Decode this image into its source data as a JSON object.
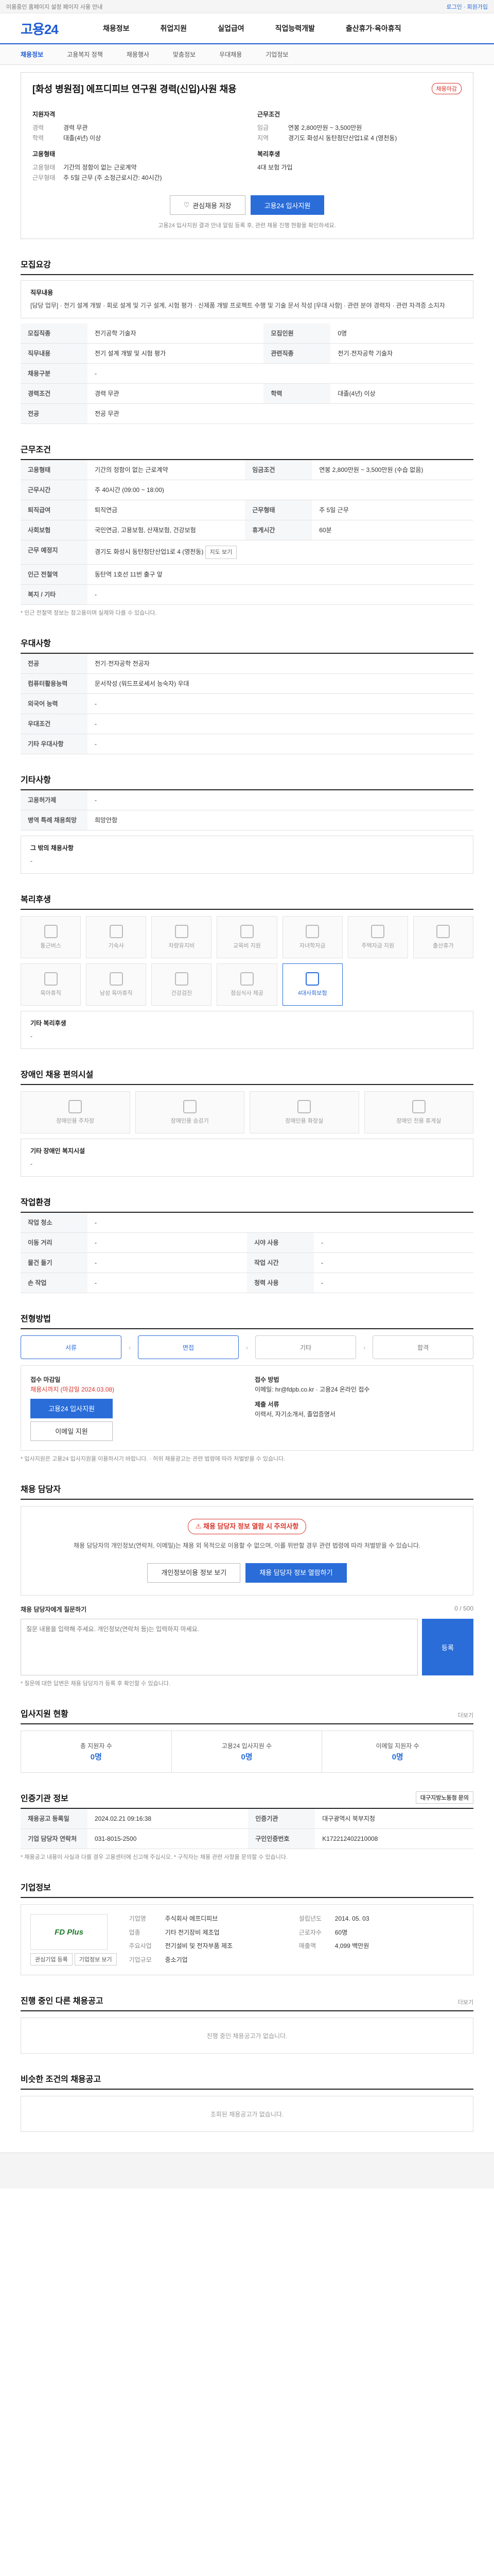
{
  "topbar": {
    "left": "이용중인 홈페이지 설정 페이지 사용 안내",
    "right": "로그인 · 회원가입"
  },
  "header": {
    "logo": "고용24",
    "menus": [
      "채용정보",
      "취업지원",
      "실업급여",
      "직업능력개발",
      "출산휴가·육아휴직"
    ]
  },
  "subnav": [
    "채용정보",
    "고용복지 정책",
    "채용행사",
    "맞춤정보",
    "우대채용",
    "기업정보"
  ],
  "job": {
    "title": "[화성 병원점] 에프디피브 연구원 경력(신입)사원 채용",
    "badge": "채용마감",
    "left_head": "지원자격",
    "left": [
      {
        "k": "경력",
        "v": "경력 무관"
      },
      {
        "k": "학력",
        "v": "대졸(4년) 이상"
      }
    ],
    "right_head": "근무조건",
    "right": [
      {
        "k": "임금",
        "v": "연봉 2,800만원 ~ 3,500만원"
      },
      {
        "k": "지역",
        "v": "경기도 화성시 동탄첨단산업1로 4 (영천동)"
      }
    ],
    "left2_head": "고용형태",
    "left2": [
      {
        "k": "고용형태",
        "v": "기간의 정함이 없는 근로계약"
      },
      {
        "k": "근무형태",
        "v": "주 5일 근무 (주 소정근로시간: 40시간)"
      }
    ],
    "right2_head": "복리후생",
    "right2": [
      {
        "k": "",
        "v": "4대 보험 가입"
      }
    ],
    "btn_scrap": "관심채용 저장",
    "btn_apply": "고용24 입사지원",
    "notice": "고용24 입사지원 결과 안내 알림 등록 후, 관련 채용 진행 현황을 확인하세요."
  },
  "recruit": {
    "title": "모집요강",
    "duty_head": "직무내용",
    "duty": "[담당 업무] · 전기 설계 개발 · 회로 설계 및 기구 설계, 시험 평가 · 신제품 개발 프로젝트 수행 및 기술 문서 작성 [우대 사항] · 관련 분야 경력자 · 관련 자격증 소지자",
    "rows": [
      {
        "k": "모집직종",
        "v": "전기공학 기술자",
        "k2": "모집인원",
        "v2": "0명"
      },
      {
        "k": "직무내용",
        "v": "전기 설계 개발 및 시험 평가",
        "k2": "관련직종",
        "v2": "전기·전자공학 기술자"
      },
      {
        "k": "채용구분",
        "v": "-"
      },
      {
        "k": "경력조건",
        "v": "경력 무관",
        "k2": "학력",
        "v2": "대졸(4년) 이상"
      },
      {
        "k": "전공",
        "v": "전공 무관"
      }
    ]
  },
  "conditions": {
    "title": "근무조건",
    "rows": [
      {
        "k": "고용형태",
        "v": "기간의 정함이 없는 근로계약",
        "k2": "임금조건",
        "v2": "연봉 2,800만원 ~ 3,500만원 (수습 없음)"
      },
      {
        "k": "근무시간",
        "v": "주 40시간 (09:00 ~ 18:00)"
      },
      {
        "k": "퇴직급여",
        "v": "퇴직연금",
        "k2": "근무형태",
        "v2": "주 5일 근무"
      },
      {
        "k": "사회보험",
        "v": "국민연금, 고용보험, 산재보험, 건강보험",
        "k2": "휴게시간",
        "v2": "60분"
      },
      {
        "k": "근무 예정지",
        "v": "경기도 화성시 동탄첨단산업1로 4 (영천동)"
      },
      {
        "k": "인근 전철역",
        "v": "동탄역 1호선 11번 출구 앞"
      },
      {
        "k": "복지 / 기타",
        "v": "-"
      }
    ],
    "note": "* 인근 전철역 정보는 참고용이며 실제와 다를 수 있습니다."
  },
  "prefer": {
    "title": "우대사항",
    "rows": [
      {
        "k": "전공",
        "v": "전기·전자공학 전공자"
      },
      {
        "k": "컴퓨터활용능력",
        "v": "문서작성 (워드프로세서 능숙자) 우대"
      },
      {
        "k": "외국어 능력",
        "v": "-"
      },
      {
        "k": "우대조건",
        "v": "-"
      },
      {
        "k": "기타 우대사항",
        "v": "-"
      }
    ]
  },
  "etc": {
    "title": "기타사항",
    "rows": [
      {
        "k": "고용허가제",
        "v": "-"
      },
      {
        "k": "병역 특례 채용희망",
        "v": "희망안함"
      }
    ],
    "extra": "그 밖의 채용사항",
    "extra_v": "-"
  },
  "welfare": {
    "title": "복리후생",
    "items": [
      "통근버스",
      "기숙사",
      "차량유지비",
      "교육비 지원",
      "자녀학자금",
      "주택자금 지원",
      "출산휴가",
      "육아휴직",
      "남성 육아휴직",
      "건강검진",
      "점심식사 제공",
      "4대사회보험"
    ],
    "etc_head": "기타 복리후생",
    "etc_v": "-"
  },
  "disabled": {
    "title": "장애인 채용 편의시설",
    "items": [
      "장애인용 주차장",
      "장애인용 승강기",
      "장애인용 화장실",
      "장애인 전용 휴게실"
    ],
    "etc_head": "기타 장애인 복지시설",
    "etc_v": "-"
  },
  "work": {
    "title": "작업환경",
    "rows": [
      {
        "k": "작업 청소",
        "v": "-"
      },
      {
        "k": "이동 거리",
        "v": "-",
        "k2": "시야 사용",
        "v2": "-"
      },
      {
        "k": "물건 들기",
        "v": "-",
        "k2": "작업 시간",
        "v2": "-"
      },
      {
        "k": "손 작업",
        "v": "-",
        "k2": "청력 사용",
        "v2": "-"
      }
    ]
  },
  "process": {
    "title": "전형방법",
    "steps": [
      "서류",
      "면접",
      "기타",
      "합격"
    ],
    "apply_head": "접수 마감일",
    "apply_v": "채용시까지 (마감일 2024.03.08)",
    "btn1": "고용24 입사지원",
    "btn2": "이메일 지원",
    "method_head": "접수 방법",
    "method_v": "이메일: hr@fdpb.co.kr · 고용24 온라인 접수",
    "doc_head": "제출 서류",
    "doc_v": "이력서, 자기소개서, 졸업증명서",
    "notes": "* 입사지원은 고용24 입사지원을 이용하시기 바랍니다. · 허위 채용광고는 관련 법령에 따라 처벌받을 수 있습니다."
  },
  "contact": {
    "title": "채용 담당자",
    "warn_h": "채용 담당자 정보 열람 시 주의사항",
    "warn_t": "채용 담당자의 개인정보(연락처, 이메일)는 채용 외 목적으로 이용할 수 없으며, 이를 위반할 경우 관련 법령에 따라 처벌받을 수 있습니다.",
    "btn1": "개인정보이용 정보 보기",
    "btn2": "채용 담당자 정보 열람하기",
    "qa_head": "채용 담당자에게 질문하기",
    "qa_count": "0 / 500",
    "qa_ph": "질문 내용을 입력해 주세요. 개인정보(연락처 등)는 입력하지 마세요.",
    "qa_btn": "등록",
    "qa_note": "* 질문에 대한 답변은 채용 담당자가 등록 후 확인할 수 있습니다."
  },
  "status": {
    "title": "입사지원 현황",
    "more": "더보기",
    "items": [
      {
        "k": "총 지원자 수",
        "v": "0명"
      },
      {
        "k": "고용24 입사지원 수",
        "v": "0명"
      },
      {
        "k": "이메일 지원자 수",
        "v": "0명"
      }
    ]
  },
  "info": {
    "title": "인증기관 정보",
    "btn": "대구지방노동청 문의",
    "rows": [
      {
        "k": "채용공고 등록일",
        "v": "2024.02.21 09:16:38",
        "k2": "인증기관",
        "v2": "대구광역시 북부지청"
      },
      {
        "k": "기업 담당자 연락처",
        "v": "031-8015-2500",
        "k2": "구인인증번호",
        "v2": "K172212402210008"
      }
    ],
    "notes": "* 채용공고 내용이 사실과 다를 경우 고용센터에 신고해 주십시오. * 구직자는 채용 관련 사항을 문의할 수 있습니다."
  },
  "company": {
    "title": "기업정보",
    "logo": "FD Plus",
    "btn_a": "관심기업 등록",
    "btn_b": "기업정보 보기",
    "rows": [
      {
        "k": "기업명",
        "v": "주식회사 에프디피브",
        "k2": "설립년도",
        "v2": "2014. 05. 03"
      },
      {
        "k": "업종",
        "v": "기타 전기장비 제조업",
        "k2": "근로자수",
        "v2": "60명"
      },
      {
        "k": "주요사업",
        "v": "전기설비 및 전자부품 제조",
        "k2": "매출액",
        "v2": "4,099 백만원"
      },
      {
        "k": "기업규모",
        "v": "중소기업",
        "k2": "",
        "v2": ""
      }
    ]
  },
  "other": {
    "title": "진행 중인 다른 채용공고",
    "empty": "진행 중인 채용공고가 없습니다.",
    "more": "더보기"
  },
  "similar": {
    "title": "비슷한 조건의 채용공고",
    "empty": "조회된 채용공고가 없습니다."
  }
}
